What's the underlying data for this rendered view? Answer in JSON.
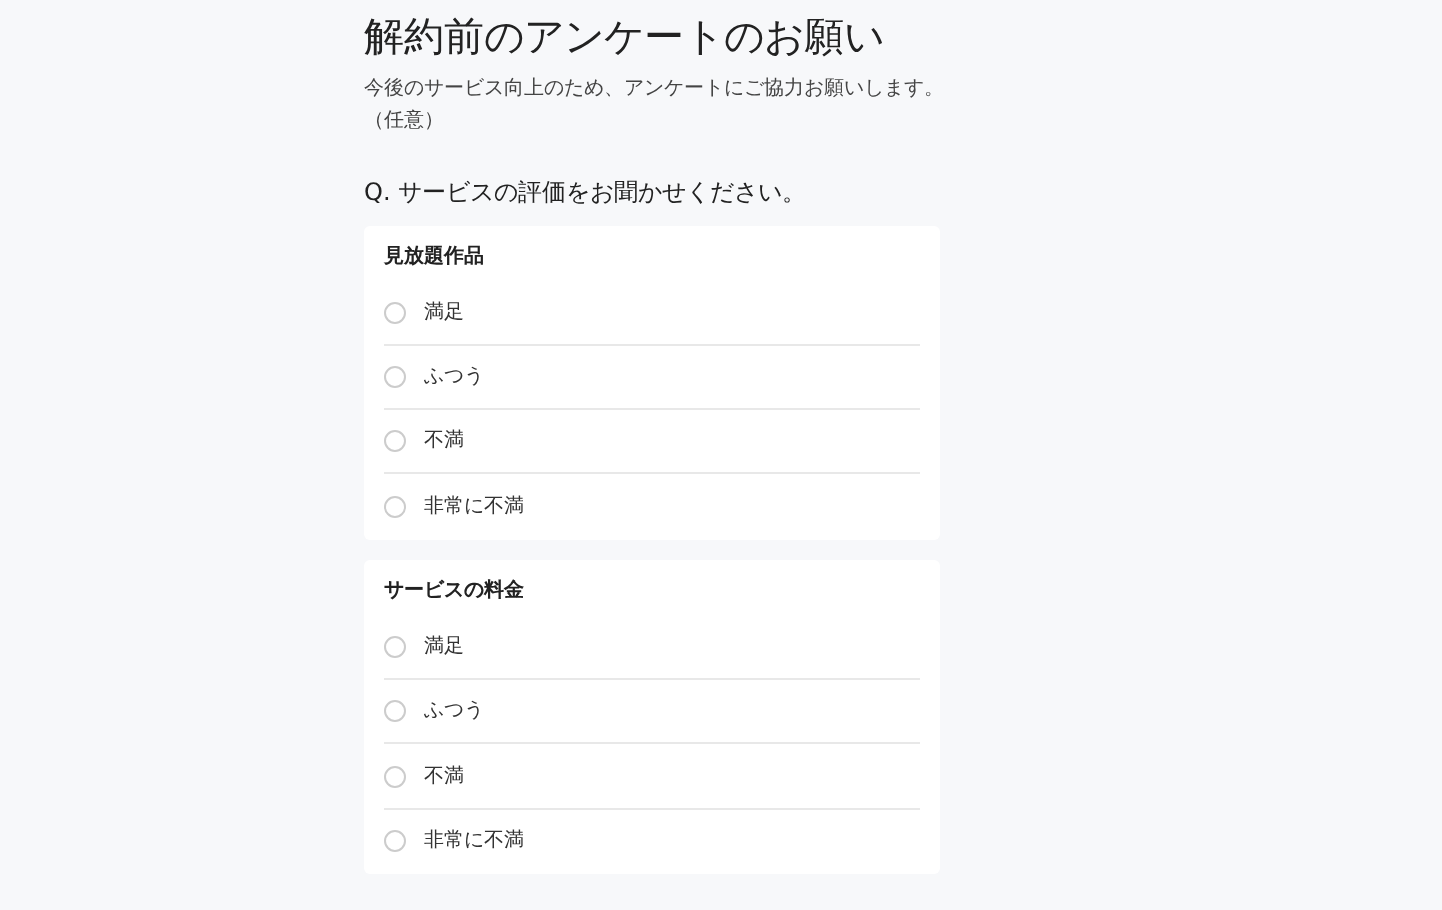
{
  "title": "解約前のアンケートのお願い",
  "description": "今後のサービス向上のため、アンケートにご協力お願いします。",
  "note": "（任意）",
  "question": "Q. サービスの評価をお聞かせください。",
  "groups": [
    {
      "title": "見放題作品",
      "options": [
        {
          "label": "満足",
          "selected": false
        },
        {
          "label": "ふつう",
          "selected": false
        },
        {
          "label": "不満",
          "selected": false
        },
        {
          "label": "非常に不満",
          "selected": false
        }
      ]
    },
    {
      "title": "サービスの料金",
      "options": [
        {
          "label": "満足",
          "selected": false
        },
        {
          "label": "ふつう",
          "selected": false
        },
        {
          "label": "不満",
          "selected": false
        },
        {
          "label": "非常に不満",
          "selected": false
        }
      ]
    }
  ]
}
